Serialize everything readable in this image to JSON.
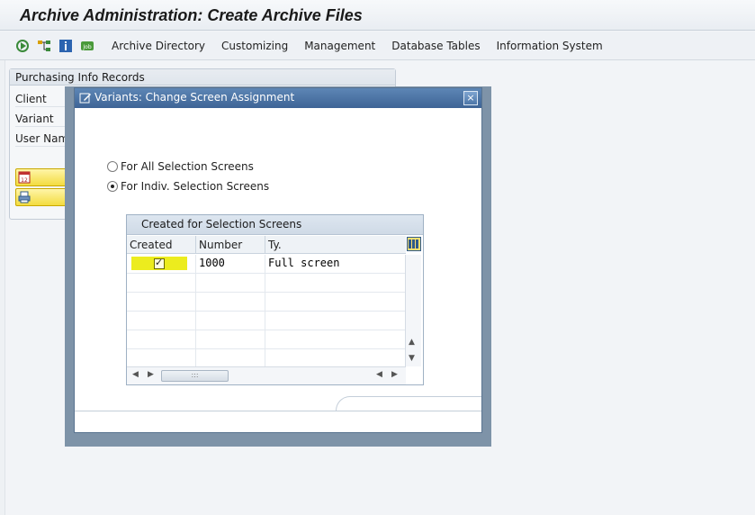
{
  "window": {
    "title": "Archive Administration: Create Archive Files"
  },
  "toolbar": {
    "icons": [
      "execute-icon",
      "hierarchy-icon",
      "info-icon",
      "job-icon"
    ],
    "menu": [
      {
        "label": "Archive Directory"
      },
      {
        "label": "Customizing"
      },
      {
        "label": "Management"
      },
      {
        "label": "Database Tables"
      },
      {
        "label": "Information System"
      }
    ]
  },
  "panel": {
    "title": "Purchasing Info Records",
    "fields": [
      {
        "label": "Client"
      },
      {
        "label": "Variant"
      },
      {
        "label": "User Nam"
      }
    ]
  },
  "dialog": {
    "title": "Variants: Change Screen Assignment",
    "close_label": "×",
    "options": [
      {
        "label": "For All Selection Screens",
        "selected": false
      },
      {
        "label": "For Indiv. Selection Screens",
        "selected": true
      }
    ],
    "table": {
      "title": "Created for Selection Screens",
      "columns": [
        "Created",
        "Number",
        "Ty."
      ],
      "rows": [
        {
          "created": true,
          "number": "1000",
          "type": "Full screen"
        }
      ],
      "hscroll_thumb": ":::"
    }
  },
  "colors": {
    "title_bar": "#3e6496",
    "checkbox_highlight": "#ecec1e",
    "side_button": "#f3dc40"
  }
}
